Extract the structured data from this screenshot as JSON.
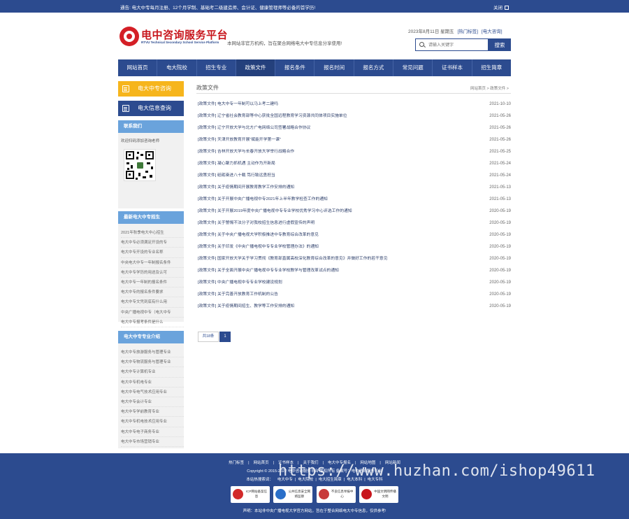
{
  "topbar": {
    "notice": "通告: 电大中专每月注册、12个月学制、基础考二级建造师、会计证、健康管理师等必备的首学历!",
    "close_label": "关闭"
  },
  "header": {
    "site_title": "电中咨询服务平台",
    "site_subtitle": "RTVU Technical Secondary School Service Platform",
    "slogan": "本网站非官方机构，旨在聚合网络电大中专信息分享使用!",
    "date": "2023年8月11日 星期五",
    "link_hot": "[热门标签]",
    "link_consult": "[电大咨询]",
    "search_placeholder": "请输入关键字",
    "search_button": "搜索"
  },
  "nav": {
    "items": [
      {
        "label": "网站首页"
      },
      {
        "label": "电大院校"
      },
      {
        "label": "招生专业"
      },
      {
        "label": "政策文件"
      },
      {
        "label": "报名条件"
      },
      {
        "label": "报名时间"
      },
      {
        "label": "报名方式"
      },
      {
        "label": "常见问题"
      },
      {
        "label": "证书样本"
      },
      {
        "label": "招生简章"
      }
    ],
    "active_index": 3
  },
  "sidebar": {
    "btn_consult": "电大中专咨询",
    "btn_cert_query": "电大信息查询",
    "contact": {
      "title": "联系我们",
      "text": "欢迎扫码添加咨询老师"
    },
    "recruit": {
      "title": "最新电大中专招生",
      "items": [
        "2021年秋季电大中心招生",
        "电大中专必须满足开设的专",
        "电大中专开设的专业名称",
        "中央电大中专一年制报名条件",
        "电大中专学历的用途及认可",
        "电大中专一年制的报名条件",
        "电大中专的报名条件要求",
        "电大中专文凭到底有什么用",
        "中央广播电视中专（电大中专",
        "电大中专报考条件是什么"
      ]
    },
    "majors": {
      "title": "电大中专专业介绍",
      "items": [
        "电大中专旅游服务与管理专业",
        "电大中专物流服务与管理专业",
        "电大中专计算机专业",
        "电大中专机电专业",
        "电大中专电气技术应用专业",
        "电大中专会计专业",
        "电大中专学前教育专业",
        "电大中专机电技术应用专业",
        "电大中专电子商务专业",
        "电大中专市场营销专业"
      ]
    }
  },
  "main": {
    "section_title": "政策文件",
    "breadcrumb": "网站首页 > 政策文件 >",
    "articles": [
      {
        "title": "[政策文件] 电大中专一年制可以马上考二建吗",
        "date": "2021-10-10"
      },
      {
        "title": "[政策文件] 辽宁省社会教育部等中心获批全国远程教育学习资源共同体项目实施单位",
        "date": "2021-05-26"
      },
      {
        "title": "[政策文件] 辽宁开放大学与北方广电网络公司签署战略合作协议",
        "date": "2021-05-26"
      },
      {
        "title": "[政策文件] 天津开放教育开展“赋能开学第一课”",
        "date": "2021-05-26"
      },
      {
        "title": "[政策文件] 吉林开放大学与长春开放大学举行战略合作",
        "date": "2021-05-25"
      },
      {
        "title": "[政策文件] 凝心聚力抓机遇 主动作为开新局",
        "date": "2021-05-24"
      },
      {
        "title": "[政策文件] 砥砺奋进八十载 笃行致远勇担当",
        "date": "2021-05-24"
      },
      {
        "title": "[政策文件] 关于疫情期间开展教育教学工作安排的通知",
        "date": "2021-05-13"
      },
      {
        "title": "[政策文件] 关于开展中央广播电视中专2021年上半年教学检查工作的通知",
        "date": "2021-05-13"
      },
      {
        "title": "[政策文件] 关于开展2019年度中央广播电视中专专业学校优秀学习中心评选工作的通知",
        "date": "2020-05-19"
      },
      {
        "title": "[政策文件] 关于警惕不法分子对我校招生信息进行虚假宣传的声明",
        "date": "2020-05-19"
      },
      {
        "title": "[政策文件] 关于中央广播电视大学积极推进中专教育综合改革的意见",
        "date": "2020-05-19"
      },
      {
        "title": "[政策文件] 关于印发《中央广播电视中专专业学校管理办法》的通知",
        "date": "2020-05-19"
      },
      {
        "title": "[政策文件] 国家开放大学关于学习贯彻《教育部直属高校深化教育综合改革的意见》并做好工作的若干意见",
        "date": "2020-05-19"
      },
      {
        "title": "[政策文件] 关于全面开展中央广播电视中专专业学校教学与管理改革试点的通知",
        "date": "2020-05-19"
      },
      {
        "title": "[政策文件] 中央广播电视中专专业学校建设规划",
        "date": "2020-05-19"
      },
      {
        "title": "[政策文件] 关于完善开放教育工作机制的公告",
        "date": "2020-05-19"
      },
      {
        "title": "[政策文件] 关于疫情期间招生、教学等工作安排的通知",
        "date": "2020-05-19"
      }
    ],
    "pager_total": "共18条",
    "pager_page": "1"
  },
  "footer": {
    "links": [
      "热门标签",
      "网站首页",
      "证书样本",
      "关于我们",
      "电大中专报名",
      "网站地图",
      "网站新闻"
    ],
    "copyright": "Copyright © 2015-2022  电中咨询服务平台 版权所有  备案号：电中咨询服务平台",
    "keywords": [
      "本站热搜索词：",
      "电大中专",
      "电大院校",
      "电大招生简章",
      "电大本科",
      "电大专科"
    ],
    "badges": [
      {
        "text": "ICP网站备案信息",
        "color": "#d22a2a"
      },
      {
        "text": "公共信息安全网络监察",
        "color": "#2a6fc9"
      },
      {
        "text": "不良信息举报中心",
        "color": "#c83b3b"
      },
      {
        "text": "中国文明网传播文明",
        "color": "#c8161d"
      }
    ],
    "note": "声明：本站非中央广播电视大学官方网站，旨在于整合网络电大中专信息，仅供参考!"
  },
  "watermark": "https://www.huzhan.com/ishop49611"
}
